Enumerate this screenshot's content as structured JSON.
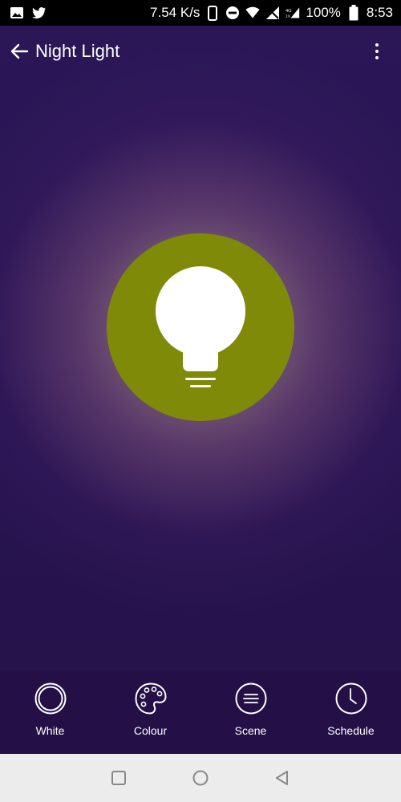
{
  "status_bar": {
    "speed": "7.54 K/s",
    "network_label": "4G",
    "battery": "100%",
    "time": "8:53"
  },
  "app_bar": {
    "title": "Night Light"
  },
  "bulb": {
    "state": "on",
    "color": "#7e8a08"
  },
  "tabs": [
    {
      "label": "White",
      "icon": "white-circle-icon"
    },
    {
      "label": "Colour",
      "icon": "palette-icon"
    },
    {
      "label": "Scene",
      "icon": "scene-lines-icon"
    },
    {
      "label": "Schedule",
      "icon": "clock-icon"
    }
  ],
  "nav": {
    "items": [
      "recents-square-icon",
      "home-circle-icon",
      "back-triangle-icon"
    ]
  }
}
